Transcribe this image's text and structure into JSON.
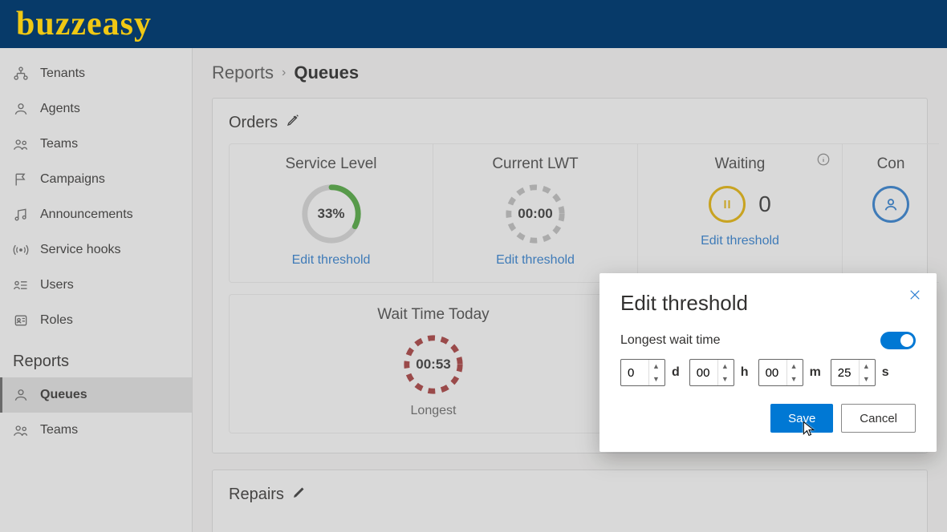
{
  "brand": "buzzeasy",
  "sidebar": {
    "items": [
      {
        "label": "Tenants"
      },
      {
        "label": "Agents"
      },
      {
        "label": "Teams"
      },
      {
        "label": "Campaigns"
      },
      {
        "label": "Announcements"
      },
      {
        "label": "Service hooks"
      },
      {
        "label": "Users"
      },
      {
        "label": "Roles"
      }
    ],
    "reports_section": "Reports",
    "reports_items": [
      {
        "label": "Queues"
      },
      {
        "label": "Teams"
      }
    ]
  },
  "breadcrumb": {
    "root": "Reports",
    "current": "Queues"
  },
  "panels": {
    "orders": {
      "title": "Orders",
      "cards": {
        "service_level": {
          "title": "Service Level",
          "value": "33%",
          "link": "Edit threshold"
        },
        "current_lwt": {
          "title": "Current LWT",
          "value": "00:00",
          "link": "Edit threshold"
        },
        "waiting": {
          "title": "Waiting",
          "count": "0",
          "link": "Edit threshold"
        },
        "conv": {
          "title": "Con"
        }
      },
      "wait_time": {
        "title": "Wait Time Today",
        "value": "00:53",
        "sublabel": "Longest"
      }
    },
    "repairs": {
      "title": "Repairs"
    }
  },
  "dialog": {
    "title": "Edit threshold",
    "label": "Longest wait time",
    "d": "0",
    "h": "00",
    "m": "00",
    "s": "25",
    "unit_d": "d",
    "unit_h": "h",
    "unit_m": "m",
    "unit_s": "s",
    "save": "Save",
    "cancel": "Cancel"
  }
}
